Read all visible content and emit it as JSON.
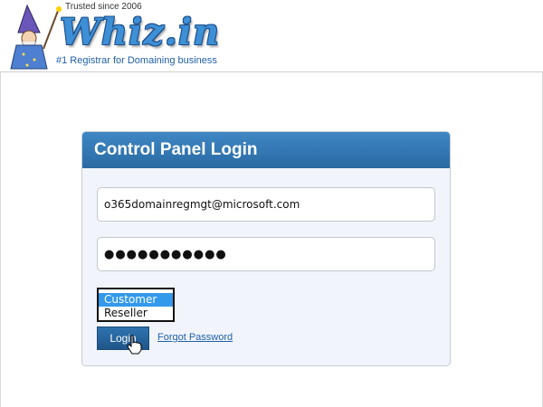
{
  "header": {
    "tagline_top": "Trusted since 2006",
    "logo_text": "Whiz.in",
    "tagline_bottom": "#1 Registrar for Domaining business"
  },
  "login_panel": {
    "title": "Control Panel Login",
    "username_value": "o365domainregmgt@microsoft.com",
    "password_masked": "●●●●●●●●●●●",
    "account_type_options": [
      "Customer",
      "Reseller"
    ],
    "account_type_selected": "Customer",
    "login_label": "Login",
    "forgot_password_label": "Forgot Password"
  },
  "colors": {
    "panel_header": "#2f75b3",
    "selected_option": "#3399ea",
    "link": "#1f5fa8"
  }
}
